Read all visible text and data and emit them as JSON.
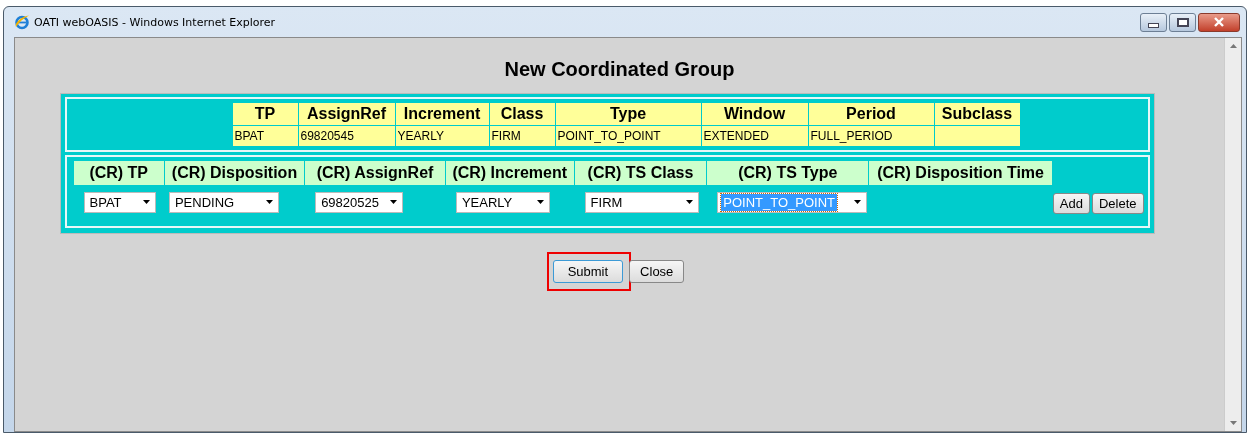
{
  "window": {
    "title": "OATI webOASIS - Windows Internet Explorer"
  },
  "page_title": "New Coordinated Group",
  "reference_table": {
    "columns": [
      {
        "header": "TP",
        "value": "BPAT"
      },
      {
        "header": "AssignRef",
        "value": "69820545"
      },
      {
        "header": "Increment",
        "value": "YEARLY"
      },
      {
        "header": "Class",
        "value": "FIRM"
      },
      {
        "header": "Type",
        "value": "POINT_TO_POINT"
      },
      {
        "header": "Window",
        "value": "EXTENDED"
      },
      {
        "header": "Period",
        "value": "FULL_PERIOD"
      },
      {
        "header": "Subclass"
      }
    ]
  },
  "cr_table": {
    "columns": [
      {
        "header": "(CR) TP",
        "select": {
          "value": "BPAT",
          "focused": false
        }
      },
      {
        "header": "(CR) Disposition",
        "select": {
          "value": "PENDING",
          "focused": false
        }
      },
      {
        "header": "(CR) AssignRef",
        "select": {
          "value": "69820525",
          "focused": false
        }
      },
      {
        "header": "(CR) Increment",
        "select": {
          "value": "YEARLY",
          "focused": false
        }
      },
      {
        "header": "(CR) TS Class",
        "select": {
          "value": "FIRM",
          "focused": false
        }
      },
      {
        "header": "(CR) TS Type",
        "select": {
          "value": "POINT_TO_POINT",
          "focused": true
        }
      },
      {
        "header": "(CR) Disposition Time"
      }
    ],
    "buttons": [
      "Add",
      "Delete"
    ]
  },
  "buttons": [
    {
      "label": "Submit",
      "highlighted": true
    },
    {
      "label": "Close",
      "highlighted": false
    }
  ]
}
